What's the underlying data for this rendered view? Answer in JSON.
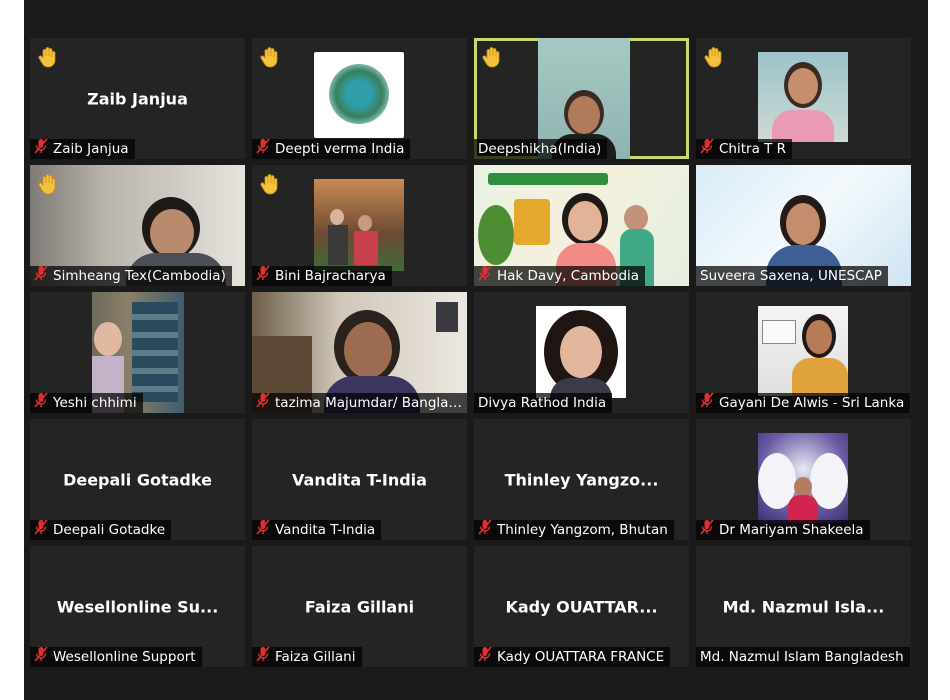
{
  "meeting": {
    "participants": [
      {
        "big_name": "Zaib Janjua",
        "label": "Zaib Janjua",
        "hand": true,
        "muted": true,
        "video": ""
      },
      {
        "big_name": "",
        "label": "Deepti verma India",
        "hand": true,
        "muted": true,
        "video": "logo"
      },
      {
        "big_name": "",
        "label": "Deepshikha(India)",
        "hand": true,
        "muted": false,
        "video": "deep",
        "active": true
      },
      {
        "big_name": "",
        "label": "Chitra T R",
        "hand": true,
        "muted": true,
        "video": "chitra"
      },
      {
        "big_name": "",
        "label": "Simheang Tex(Cambodia)",
        "hand": true,
        "muted": true,
        "video": "sim"
      },
      {
        "big_name": "",
        "label": "Bini Bajracharya",
        "hand": true,
        "muted": true,
        "video": "bini"
      },
      {
        "big_name": "",
        "label": "Hak Davy, Cambodia",
        "hand": false,
        "muted": true,
        "video": "hak"
      },
      {
        "big_name": "",
        "label": "Suveera Saxena, UNESCAP",
        "hand": false,
        "muted": false,
        "video": "suv"
      },
      {
        "big_name": "",
        "label": "Yeshi chhimi",
        "hand": false,
        "muted": true,
        "video": "yeshi"
      },
      {
        "big_name": "",
        "label": "tazima Majumdar/ Banglad...",
        "hand": false,
        "muted": true,
        "video": "taz"
      },
      {
        "big_name": "",
        "label": "Divya Rathod India",
        "hand": false,
        "muted": false,
        "video": "divya"
      },
      {
        "big_name": "",
        "label": "Gayani De Alwis - Sri Lanka",
        "hand": false,
        "muted": true,
        "video": "gayani"
      },
      {
        "big_name": "Deepali Gotadke",
        "label": "Deepali Gotadke",
        "hand": false,
        "muted": true,
        "video": ""
      },
      {
        "big_name": "Vandita T-India",
        "label": "Vandita T-India",
        "hand": false,
        "muted": true,
        "video": ""
      },
      {
        "big_name": "Thinley Yangzo...",
        "label": "Thinley Yangzom, Bhutan",
        "hand": false,
        "muted": true,
        "video": ""
      },
      {
        "big_name": "",
        "label": "Dr Mariyam Shakeela",
        "hand": false,
        "muted": true,
        "video": "mariyam"
      },
      {
        "big_name": "Wesellonline Su...",
        "label": "Wesellonline Support",
        "hand": false,
        "muted": true,
        "video": ""
      },
      {
        "big_name": "Faiza Gillani",
        "label": "Faiza Gillani",
        "hand": false,
        "muted": true,
        "video": ""
      },
      {
        "big_name": "Kady OUATTAR...",
        "label": "Kady OUATTARA FRANCE",
        "hand": false,
        "muted": true,
        "video": ""
      },
      {
        "big_name": "Md. Nazmul Isla...",
        "label": "Md. Nazmul Islam Bangladesh",
        "hand": false,
        "muted": false,
        "video": ""
      }
    ]
  },
  "icons": {
    "raised_hand": "raised-hand-icon",
    "muted_mic": "muted-mic-icon"
  },
  "colors": {
    "background": "#1a1a1a",
    "tile": "#242424",
    "active_outline": "#c5dc6a",
    "hand": "#f5c23c",
    "mute": "#e02f2f"
  }
}
